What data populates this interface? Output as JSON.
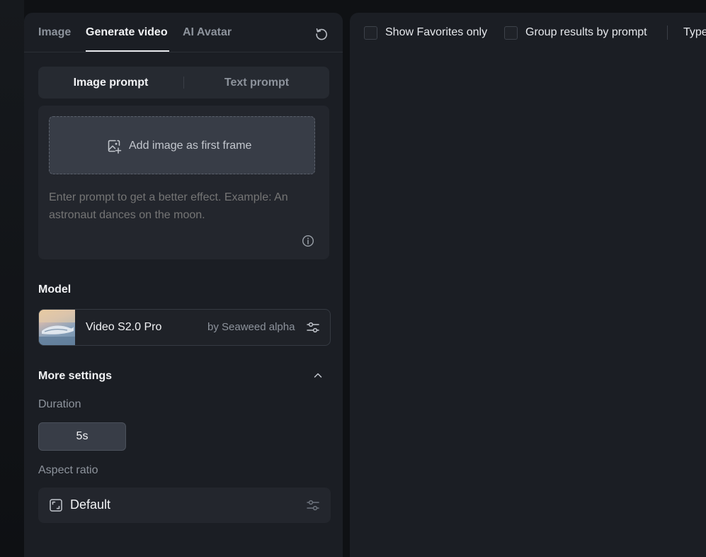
{
  "tabs": [
    {
      "label": "Image",
      "active": false
    },
    {
      "label": "Generate video",
      "active": true
    },
    {
      "label": "AI Avatar",
      "active": false
    }
  ],
  "prompt_mode": {
    "options": [
      "Image prompt",
      "Text prompt"
    ],
    "selected": "Image prompt"
  },
  "upload": {
    "label": "Add image as first frame"
  },
  "prompt": {
    "value": "",
    "placeholder": "Enter prompt to get a better effect. Example: An astronaut dances on the moon."
  },
  "model": {
    "section_title": "Model",
    "name": "Video S2.0 Pro",
    "by": "by Seaweed alpha"
  },
  "more_settings": {
    "title": "More settings",
    "expanded": true,
    "duration_label": "Duration",
    "duration_value": "5s",
    "aspect_label": "Aspect ratio",
    "aspect_value": "Default"
  },
  "filters": {
    "show_favorites": "Show Favorites only",
    "group_by_prompt": "Group results by prompt",
    "type": "Type"
  },
  "colors": {
    "background": "#0f1114",
    "panel": "#1b1e24",
    "accent_text": "#f2f3f5",
    "muted_text": "#8d939c"
  }
}
